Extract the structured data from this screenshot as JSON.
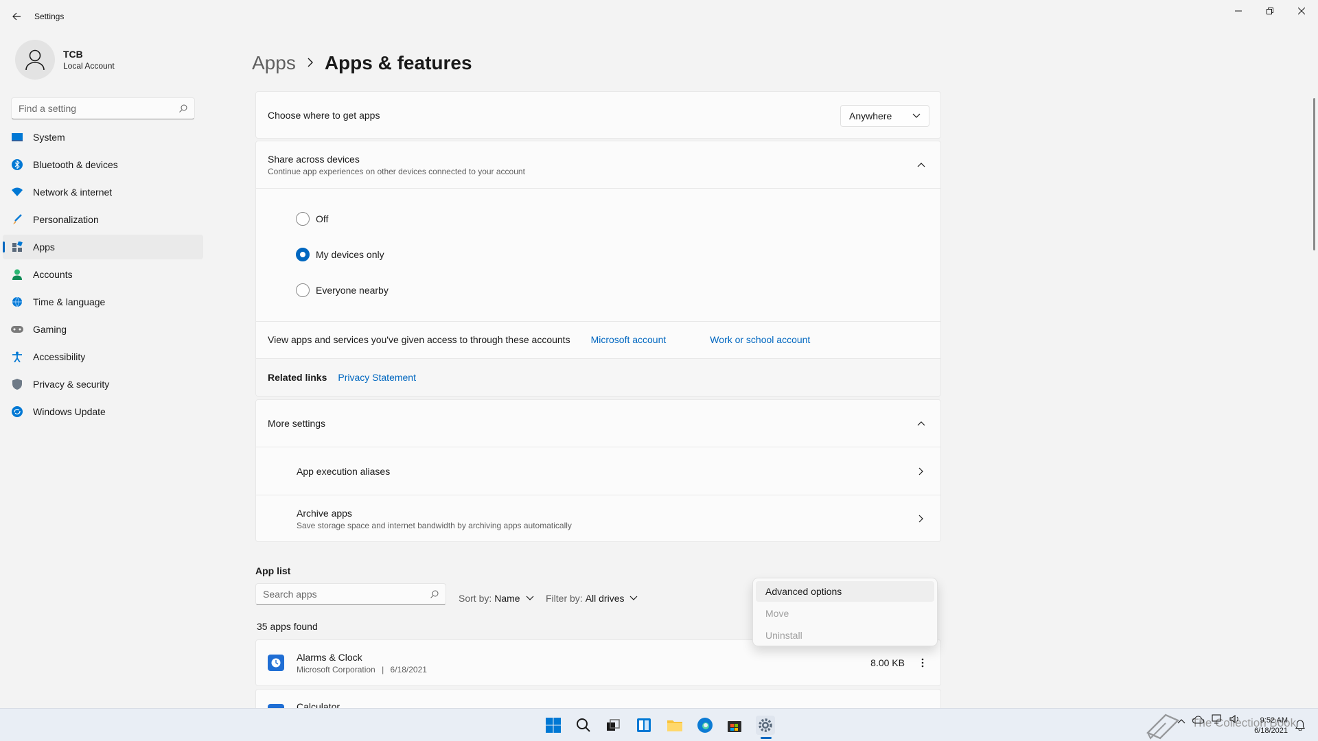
{
  "window": {
    "title": "Settings"
  },
  "profile": {
    "name": "TCB",
    "account_type": "Local Account"
  },
  "search": {
    "placeholder": "Find a setting"
  },
  "sidebar": {
    "items": [
      {
        "label": "System",
        "icon": "monitor-icon",
        "active": false
      },
      {
        "label": "Bluetooth & devices",
        "icon": "bluetooth-icon",
        "active": false
      },
      {
        "label": "Network & internet",
        "icon": "wifi-icon",
        "active": false
      },
      {
        "label": "Personalization",
        "icon": "brush-icon",
        "active": false
      },
      {
        "label": "Apps",
        "icon": "apps-icon",
        "active": true
      },
      {
        "label": "Accounts",
        "icon": "person-icon",
        "active": false
      },
      {
        "label": "Time & language",
        "icon": "globe-icon",
        "active": false
      },
      {
        "label": "Gaming",
        "icon": "gamepad-icon",
        "active": false
      },
      {
        "label": "Accessibility",
        "icon": "accessibility-icon",
        "active": false
      },
      {
        "label": "Privacy & security",
        "icon": "shield-icon",
        "active": false
      },
      {
        "label": "Windows Update",
        "icon": "update-icon",
        "active": false
      }
    ]
  },
  "breadcrumb": {
    "parent": "Apps",
    "current": "Apps & features"
  },
  "choose_apps": {
    "label": "Choose where to get apps",
    "value": "Anywhere"
  },
  "share": {
    "title": "Share across devices",
    "subtitle": "Continue app experiences on other devices connected to your account",
    "options": [
      {
        "label": "Off",
        "checked": false
      },
      {
        "label": "My devices only",
        "checked": true
      },
      {
        "label": "Everyone nearby",
        "checked": false
      }
    ],
    "accounts_text": "View apps and services you've given access to through these accounts",
    "microsoft_account": "Microsoft account",
    "work_account": "Work or school account"
  },
  "related": {
    "label": "Related links",
    "privacy": "Privacy Statement"
  },
  "more_settings": {
    "title": "More settings",
    "items": [
      {
        "title": "App execution aliases",
        "subtitle": ""
      },
      {
        "title": "Archive apps",
        "subtitle": "Save storage space and internet bandwidth by archiving apps automatically"
      }
    ]
  },
  "app_list": {
    "title": "App list",
    "search_placeholder": "Search apps",
    "sort_label": "Sort by:",
    "sort_value": "Name",
    "filter_label": "Filter by:",
    "filter_value": "All drives",
    "count": "35 apps found",
    "apps": [
      {
        "name": "Alarms & Clock",
        "publisher": "Microsoft Corporation",
        "date": "6/18/2021",
        "size": "8.00 KB"
      },
      {
        "name": "Calculator",
        "publisher": "",
        "date": "",
        "size": ""
      }
    ]
  },
  "context_menu": {
    "items": [
      {
        "label": "Advanced options",
        "disabled": false
      },
      {
        "label": "Move",
        "disabled": true
      },
      {
        "label": "Uninstall",
        "disabled": true
      }
    ]
  },
  "taskbar": {
    "time": "9:52 AM",
    "date": "6/18/2021",
    "watermark": "The Collection Book"
  },
  "colors": {
    "accent": "#0067c0",
    "background": "#f3f3f3",
    "card": "#fbfbfb"
  }
}
